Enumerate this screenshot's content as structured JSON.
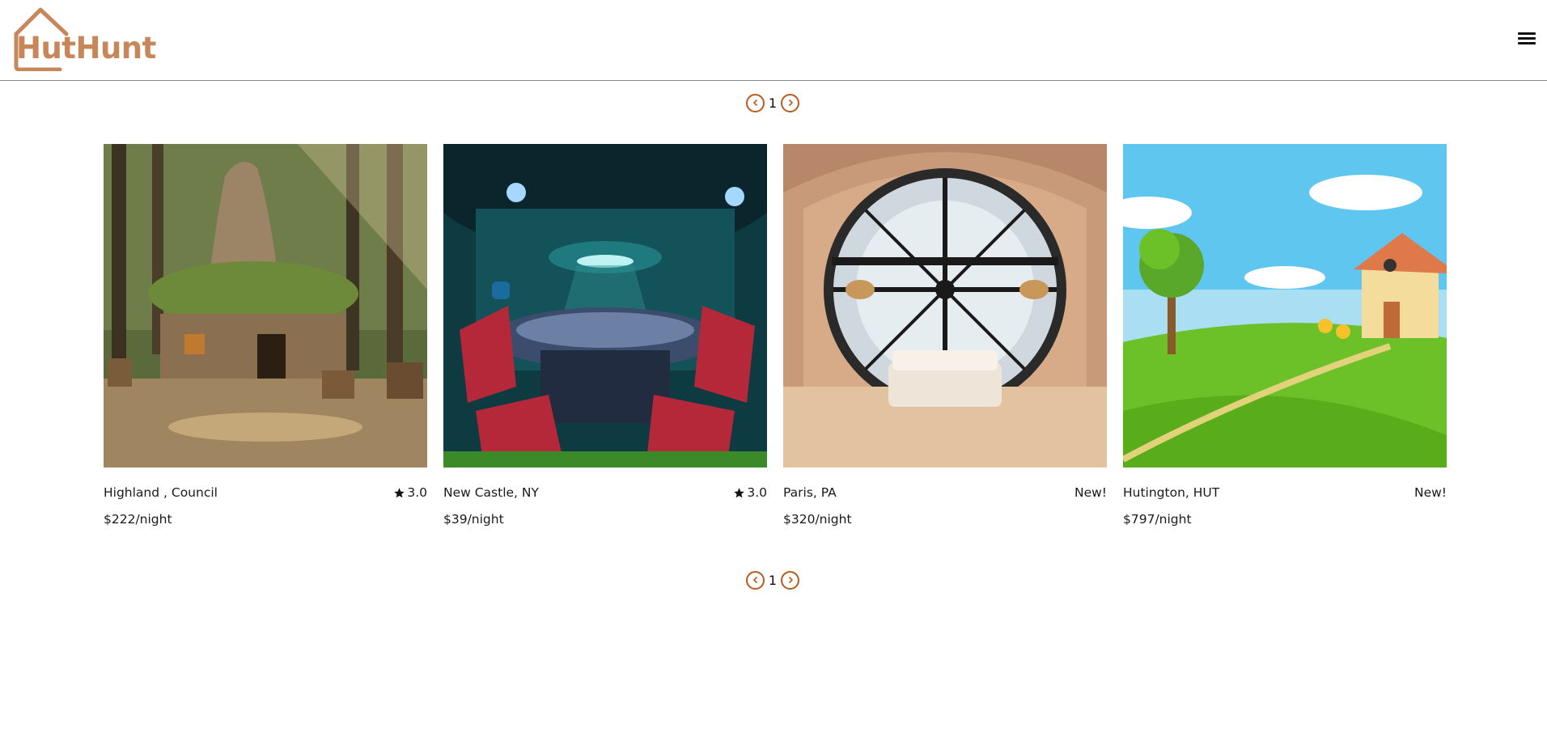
{
  "brand": {
    "name": "HutHunt",
    "color": "#c8875a"
  },
  "header": {
    "menu_icon": "hamburger-menu-icon"
  },
  "pagination": {
    "current_page": "1",
    "prev_icon": "chevron-left-icon",
    "next_icon": "chevron-right-icon",
    "accent": "#b95a1e"
  },
  "listings": [
    {
      "location": "Highland , Council",
      "rating": "3.0",
      "price": "$222/night",
      "image": "treehouse-swamp"
    },
    {
      "location": "New Castle, NY",
      "rating": "3.0",
      "price": "$39/night",
      "image": "spaceship-room"
    },
    {
      "location": "Paris, PA",
      "badge": "New!",
      "price": "$320/night",
      "image": "clock-window-bedroom"
    },
    {
      "location": "Hutington, HUT",
      "badge": "New!",
      "price": "$797/night",
      "image": "cartoon-house"
    }
  ]
}
